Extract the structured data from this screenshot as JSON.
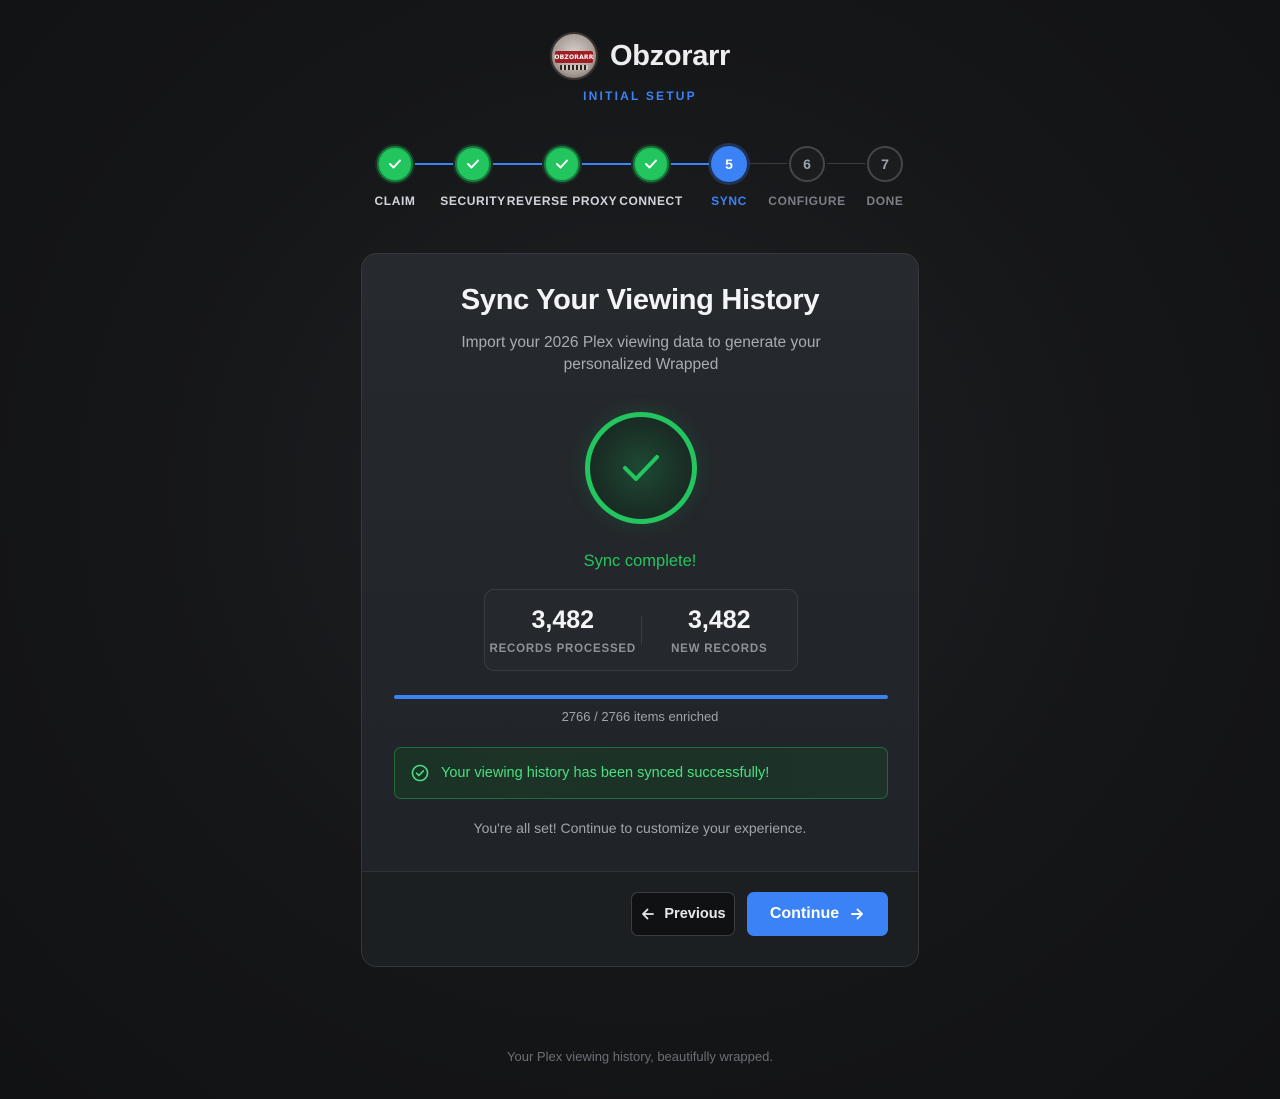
{
  "brand": {
    "name": "Obzorarr",
    "logo_text": "OBZORARR",
    "subtitle": "INITIAL SETUP"
  },
  "stepper": {
    "steps": [
      {
        "number": "1",
        "label": "CLAIM",
        "state": "done"
      },
      {
        "number": "2",
        "label": "SECURITY",
        "state": "done"
      },
      {
        "number": "3",
        "label": "REVERSE PROXY",
        "state": "done"
      },
      {
        "number": "4",
        "label": "CONNECT",
        "state": "done"
      },
      {
        "number": "5",
        "label": "SYNC",
        "state": "current"
      },
      {
        "number": "6",
        "label": "CONFIGURE",
        "state": "pending"
      },
      {
        "number": "7",
        "label": "DONE",
        "state": "pending"
      }
    ]
  },
  "card": {
    "title": "Sync Your Viewing History",
    "description": "Import your 2026 Plex viewing data to generate your personalized Wrapped",
    "status": "Sync complete!",
    "stats": [
      {
        "value": "3,482",
        "label": "RECORDS PROCESSED"
      },
      {
        "value": "3,482",
        "label": "NEW RECORDS"
      }
    ],
    "progress": {
      "fraction": 1.0,
      "text": "2766 / 2766 items enriched"
    },
    "alert": "Your viewing history has been synced successfully!",
    "note": "You're all set! Continue to customize your experience.",
    "buttons": {
      "previous": "Previous",
      "continue": "Continue"
    }
  },
  "footer": {
    "text": "Your Plex viewing history, beautifully wrapped."
  },
  "colors": {
    "accent": "#3b82f6",
    "success": "#22c55e",
    "success_text": "#4ade80"
  }
}
